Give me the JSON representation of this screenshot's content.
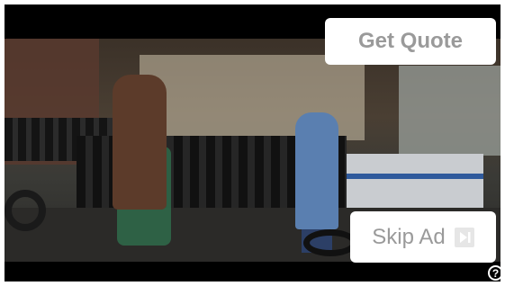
{
  "ad": {
    "cta_label": "Get Quote",
    "skip_label": "Skip Ad",
    "help_glyph": "?"
  },
  "icons": {
    "skip": "skip-next-icon",
    "help": "help-icon"
  },
  "colors": {
    "button_bg": "#ffffff",
    "button_text": "#9a9a9a",
    "player_bg": "#000000"
  }
}
